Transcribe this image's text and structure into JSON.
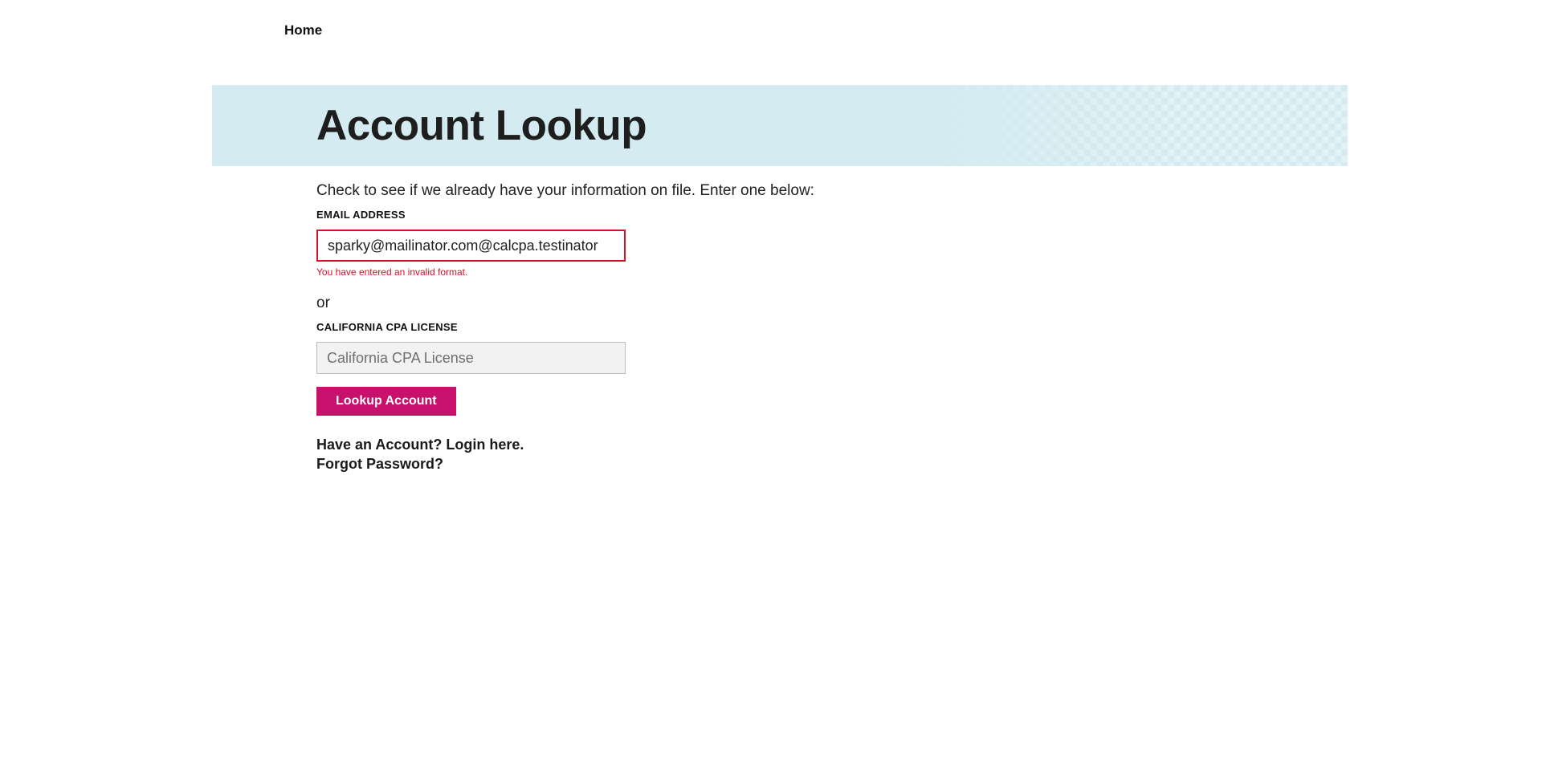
{
  "nav": {
    "home_label": "Home"
  },
  "banner": {
    "title": "Account Lookup",
    "background_color": "#d4ecf1"
  },
  "form": {
    "intro_text": "Check to see if we already have your information on file. Enter one below:",
    "email": {
      "label": "EMAIL ADDRESS",
      "value": "sparky@mailinator.com@calcpa.testinator",
      "error": "You have entered an invalid format.",
      "error_color": "#d6112b"
    },
    "separator": "or",
    "license": {
      "label": "CALIFORNIA CPA LICENSE",
      "placeholder": "California CPA License",
      "value": ""
    },
    "submit_label": "Lookup Account",
    "submit_color": "#c8106d"
  },
  "links": {
    "login": "Have an Account? Login here.",
    "forgot": "Forgot Password?"
  }
}
